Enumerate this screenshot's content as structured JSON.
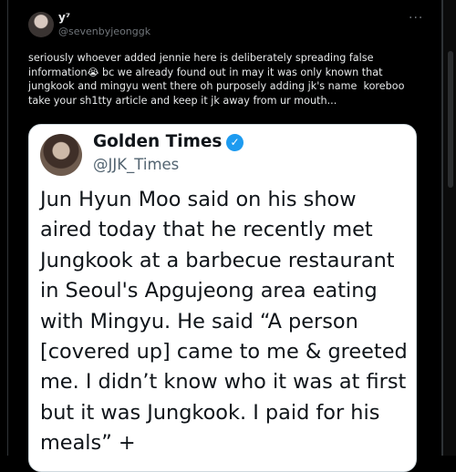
{
  "post": {
    "author_name": "y⁷",
    "author_handle": "@sevenbyjeonggk",
    "more_icon": "···",
    "text_lines": [
      "seriously whoever added jennie here is deliberately spreading false",
      "information",
      " bc we already found out in may it was only known that",
      "jungkook and mingyu went there oh purposely adding jk's name  koreboo",
      "take your sh1tty article and keep it jk away from ur mouth..."
    ],
    "emoji": "😭"
  },
  "quote": {
    "name": "Golden Times",
    "verified": "✓",
    "handle": "@JJK_Times",
    "text_lines": [
      "Jun Hyun Moo said on his show",
      "aired today that he recently met",
      "Jungkook at a barbecue restaurant",
      "in Seoul's Apgujeong area eating",
      "with Mingyu. He said “A person",
      "[covered up] came to me & greeted",
      "me. I didn’t know who it was at first",
      "but it was Jungkook. I paid for his",
      "meals” +"
    ]
  },
  "colors": {
    "background": "#000000",
    "card": "#ffffff",
    "verified_blue": "#1d9bf0"
  }
}
